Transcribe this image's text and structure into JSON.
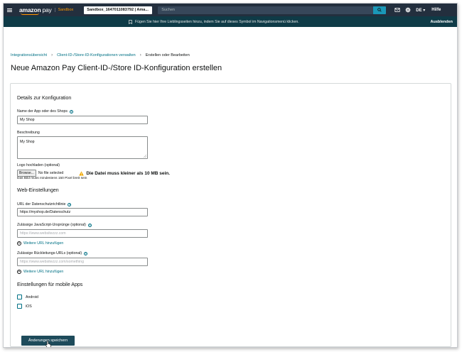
{
  "topbar": {
    "logo_amazon": "amazon",
    "logo_pay": "pay",
    "sandbox_label": "Sandbox",
    "account_selector": "Sandbox_1647011083792 | Ama...",
    "search_placeholder": "Suchen",
    "icons": [
      "menu-icon",
      "search-icon",
      "mail-icon",
      "gear-icon"
    ],
    "language": "DE ▾",
    "help": "Hilfe"
  },
  "favorites_bar": {
    "message": "Fügen Sie hier Ihre Lieblingsseiten hinzu, indem Sie auf dieses Symbol im Navigationsmenü klicken.",
    "hide_label": "Ausblenden"
  },
  "breadcrumb": {
    "items": [
      "Integrationsübersicht",
      "Client-ID-/Store-ID-Konfigurationen verwalten",
      "Erstellen oder Bearbeiten"
    ]
  },
  "page_title": "Neue Amazon Pay Client-ID-/Store ID-Konfiguration erstellen",
  "details": {
    "section_title": "Details zur Konfiguration",
    "app_name_label": "Name der App oder des Shops",
    "app_name_value": "My Shop",
    "description_label": "Beschreibung",
    "description_value": "My Shop",
    "logo_label": "Logo hochladen (optional)",
    "browse_label": "Browse...",
    "no_file_label": "No file selected",
    "file_warning": "Die Datei muss kleiner als 10 MB sein.",
    "logo_hint": "Das Bild muss mindestens 150 Pixel breit sein"
  },
  "web": {
    "section_title": "Web-Einstellungen",
    "privacy_url_label": "URL der Datenschutzrichtlinie",
    "privacy_url_value": "https://myshop.de/Datenschutz",
    "js_origins_label": "Zulässige JavaScript-Ursprünge (optional)",
    "js_origins_placeholder": "https://www.websitezzz.com",
    "add_url_label_1": "Weitere URL hinzufügen",
    "return_urls_label": "Zulässige Rückleitungs-URLs (optional)",
    "return_urls_placeholder": "https://www.websitezzz.com/something",
    "add_url_label_2": "Weitere URL hinzufügen"
  },
  "mobile": {
    "section_title": "Einstellungen für mobile Apps",
    "android_label": "Android",
    "ios_label": "iOS"
  },
  "save_button": "Änderungen speichern",
  "colors": {
    "topbar": "#232f3e",
    "favbar": "#0f3b47",
    "link": "#007185",
    "primary_button": "#1e4b5b",
    "search_button": "#1a98b8"
  }
}
